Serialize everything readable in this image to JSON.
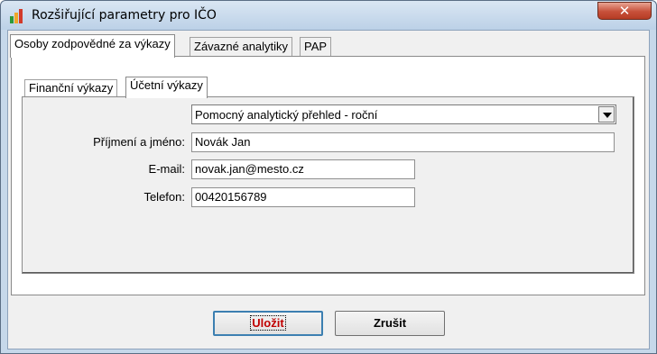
{
  "window": {
    "title": "Rozšiřující parametry pro IČO",
    "close_glyph": "✕",
    "icon": "bar-chart-icon",
    "icon_colors": [
      "#2e9a3a",
      "#f0a82a",
      "#d23a2a"
    ]
  },
  "tabs": [
    {
      "label": "Osoby zodpovědné za výkazy",
      "active": true
    },
    {
      "label": "Závazné analytiky",
      "active": false
    },
    {
      "label": "PAP",
      "active": false
    }
  ],
  "subtabs": [
    {
      "label": "Finanční výkazy",
      "active": false
    },
    {
      "label": "Účetní výkazy",
      "active": true
    }
  ],
  "form": {
    "report_select": {
      "value": "Pomocný analytický přehled - roční"
    },
    "name": {
      "label": "Příjmení a jméno:",
      "value": "Novák Jan"
    },
    "email": {
      "label": "E-mail:",
      "value": "novak.jan@mesto.cz"
    },
    "phone": {
      "label": "Telefon:",
      "value": "00420156789"
    }
  },
  "buttons": {
    "save_label": "Uložit",
    "cancel_label": "Zrušit"
  },
  "colors": {
    "title_bar": "#c6d8ea",
    "close_button": "#c7503a",
    "save_text": "#c00000",
    "default_button_border": "#3c7fb1"
  }
}
